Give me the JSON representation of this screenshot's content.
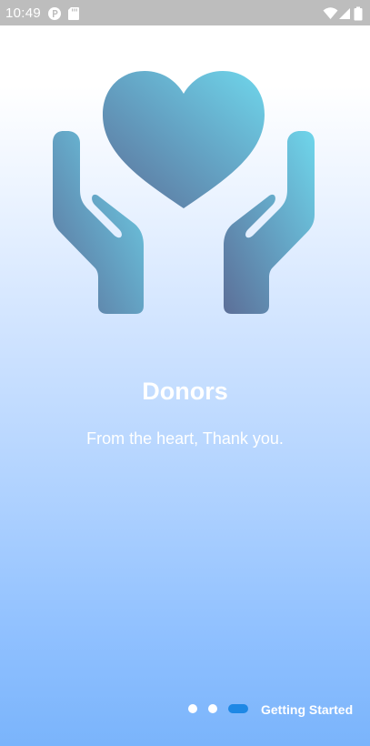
{
  "status_bar": {
    "time": "10:49",
    "icons": [
      "p-badge-icon",
      "sd-card-icon",
      "wifi-icon",
      "cell-signal-icon",
      "battery-icon"
    ]
  },
  "onboarding": {
    "illustration": "hands-holding-heart-icon",
    "title": "Donors",
    "subtitle": "From the heart, Thank you.",
    "page_indicator": {
      "count": 3,
      "active_index": 2
    },
    "cta_label": "Getting Started"
  },
  "colors": {
    "status_bar": "#bdbdbd",
    "background_top": "#ffffff",
    "background_bottom": "#7ab4fb",
    "illustration_light": "#6fd6eb",
    "illustration_dark": "#5c6f98",
    "active_indicator": "#1e88e5",
    "text": "#ffffff"
  }
}
